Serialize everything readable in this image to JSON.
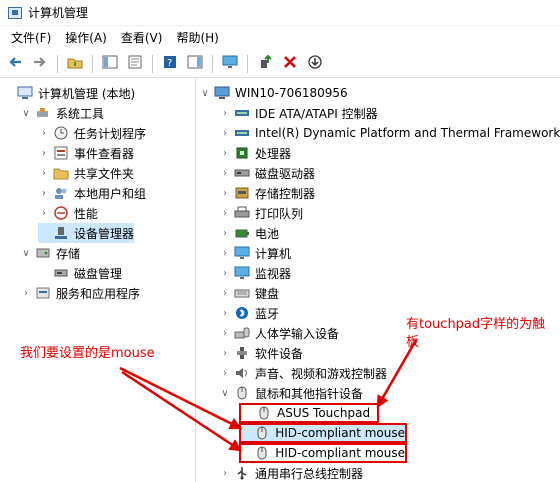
{
  "window": {
    "title": "计算机管理"
  },
  "menu": [
    "文件(F)",
    "操作(A)",
    "查看(V)",
    "帮助(H)"
  ],
  "toolbar": [
    "back-icon",
    "forward-icon",
    "up-folder-icon",
    "show-hide-tree-icon",
    "properties-icon",
    "help-icon",
    "action-pane-icon",
    "monitor-icon",
    "update-driver-icon",
    "uninstall-icon",
    "disable-icon"
  ],
  "left_tree": [
    {
      "label": "计算机管理 (本地)",
      "icon": "computer-mgmt-icon",
      "toggle": "",
      "indent": 0
    },
    {
      "label": "系统工具",
      "icon": "tools-icon",
      "toggle": "v",
      "indent": 1
    },
    {
      "label": "任务计划程序",
      "icon": "clock-icon",
      "toggle": ">",
      "indent": 2
    },
    {
      "label": "事件查看器",
      "icon": "event-viewer-icon",
      "toggle": ">",
      "indent": 2
    },
    {
      "label": "共享文件夹",
      "icon": "shared-folder-icon",
      "toggle": ">",
      "indent": 2
    },
    {
      "label": "本地用户和组",
      "icon": "users-icon",
      "toggle": ">",
      "indent": 2
    },
    {
      "label": "性能",
      "icon": "performance-icon",
      "toggle": ">",
      "indent": 2
    },
    {
      "label": "设备管理器",
      "icon": "device-manager-icon",
      "toggle": "",
      "indent": 2,
      "selected": true
    },
    {
      "label": "存储",
      "icon": "storage-icon",
      "toggle": "v",
      "indent": 1
    },
    {
      "label": "磁盘管理",
      "icon": "disk-icon",
      "toggle": "",
      "indent": 2
    },
    {
      "label": "服务和应用程序",
      "icon": "services-icon",
      "toggle": ">",
      "indent": 1
    }
  ],
  "device_tree": [
    {
      "label": "WIN10-706180956",
      "icon": "computer-icon",
      "toggle": "v",
      "indent": 0
    },
    {
      "label": "IDE ATA/ATAPI 控制器",
      "icon": "ide-icon",
      "toggle": ">",
      "indent": 1
    },
    {
      "label": "Intel(R) Dynamic Platform and Thermal Framework",
      "icon": "thermal-icon",
      "toggle": ">",
      "indent": 1
    },
    {
      "label": "处理器",
      "icon": "processor-icon",
      "toggle": ">",
      "indent": 1
    },
    {
      "label": "磁盘驱动器",
      "icon": "disk-drive-icon",
      "toggle": ">",
      "indent": 1
    },
    {
      "label": "存储控制器",
      "icon": "storage-controller-icon",
      "toggle": ">",
      "indent": 1
    },
    {
      "label": "打印队列",
      "icon": "printer-icon",
      "toggle": ">",
      "indent": 1
    },
    {
      "label": "电池",
      "icon": "battery-icon",
      "toggle": ">",
      "indent": 1
    },
    {
      "label": "计算机",
      "icon": "monitor-icon",
      "toggle": ">",
      "indent": 1
    },
    {
      "label": "监视器",
      "icon": "monitor-icon",
      "toggle": ">",
      "indent": 1
    },
    {
      "label": "键盘",
      "icon": "keyboard-icon",
      "toggle": ">",
      "indent": 1
    },
    {
      "label": "蓝牙",
      "icon": "bluetooth-icon",
      "toggle": ">",
      "indent": 1
    },
    {
      "label": "人体学输入设备",
      "icon": "hid-icon",
      "toggle": ">",
      "indent": 1
    },
    {
      "label": "软件设备",
      "icon": "software-device-icon",
      "toggle": ">",
      "indent": 1
    },
    {
      "label": "声音、视频和游戏控制器",
      "icon": "sound-icon",
      "toggle": ">",
      "indent": 1
    },
    {
      "label": "鼠标和其他指针设备",
      "icon": "mouse-icon",
      "toggle": "v",
      "indent": 1
    },
    {
      "label": "ASUS Touchpad",
      "icon": "mouse-icon",
      "toggle": "",
      "indent": 2,
      "boxed": true
    },
    {
      "label": "HID-compliant mouse",
      "icon": "mouse-icon",
      "toggle": "",
      "indent": 2,
      "boxed": true,
      "selected": true
    },
    {
      "label": "HID-compliant mouse",
      "icon": "mouse-icon",
      "toggle": "",
      "indent": 2,
      "boxed": true
    },
    {
      "label": "通用串行总线控制器",
      "icon": "usb-icon",
      "toggle": ">",
      "indent": 1
    }
  ],
  "annotations": {
    "left_note": "我们要设置的是mouse",
    "right_note_line1": "有touchpad字样的为触",
    "right_note_line2": "板",
    "color": "#e00000"
  }
}
